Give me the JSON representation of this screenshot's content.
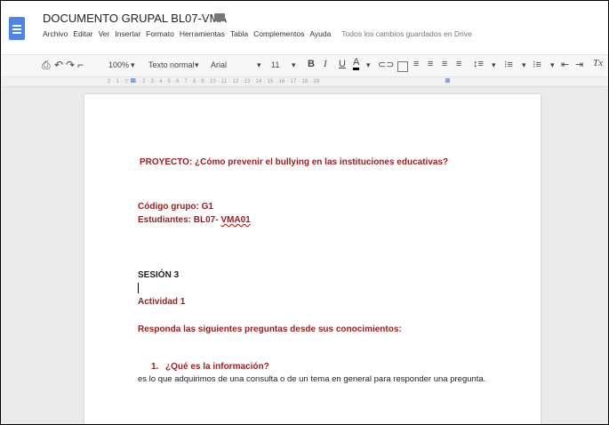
{
  "document": {
    "title": "DOCUMENTO GRUPAL BL07-VMA"
  },
  "menu": {
    "items": [
      "Archivo",
      "Editar",
      "Ver",
      "Insertar",
      "Formato",
      "Herramientas",
      "Tabla",
      "Complementos",
      "Ayuda"
    ],
    "saved_status": "Todos los cambios guardados en Drive"
  },
  "toolbar": {
    "zoom": "100%",
    "style": "Texto normal",
    "font": "Arial",
    "size": "11"
  },
  "ruler": {
    "text": "2 · 1 · ▽ · 1 · 2 · 3 · 4 · 5 · 6 · 7 · 8 · 9 · 10 · 11 · 12 · 13 · 14 · 15 · 16 · 17 · 18 · 19"
  },
  "content": {
    "project": "PROYECTO: ¿Cómo prevenir el bullying en las instituciones educativas?",
    "group_code": "Código grupo: G1",
    "students_label": "Estudiantes: BL07-",
    "students_id": "VMA01",
    "session": "SESIÓN 3",
    "activity": "Actividad 1",
    "instruction": "Responda las siguientes preguntas desde sus conocimientos:",
    "question_number": "1.",
    "question": "¿Qué es la información?",
    "answer": "es lo que adquirimos de una consulta o de un tema en general para responder una pregunta."
  }
}
